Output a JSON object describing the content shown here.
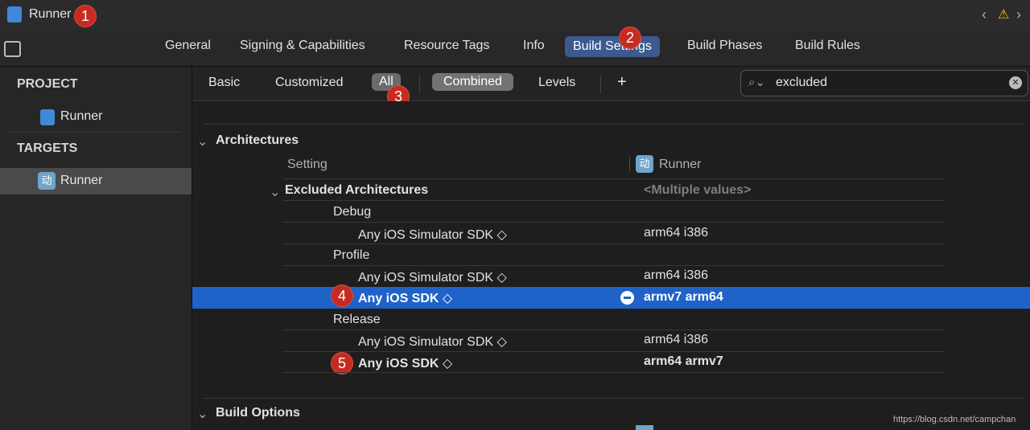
{
  "window": {
    "title": "Runner"
  },
  "badges": [
    "1",
    "2",
    "3",
    "4",
    "5"
  ],
  "tabs": [
    "General",
    "Signing & Capabilities",
    "Resource Tags",
    "Info",
    "Build Settings",
    "Build Phases",
    "Build Rules"
  ],
  "sidebar": {
    "project_header": "PROJECT",
    "project_item": "Runner",
    "targets_header": "TARGETS",
    "target_item": "Runner",
    "target_icon_glyph": "动"
  },
  "filters": {
    "basic": "Basic",
    "customized": "Customized",
    "all": "All",
    "combined": "Combined",
    "levels": "Levels",
    "add": "+"
  },
  "search": {
    "value": "excluded"
  },
  "content": {
    "section1": "Architectures",
    "col_setting": "Setting",
    "col_target": "Runner",
    "setting_name": "Excluded Architectures",
    "setting_value": "<Multiple values>",
    "debug": "Debug",
    "debug_sim": "Any iOS Simulator SDK ◇",
    "debug_sim_val": "arm64 i386",
    "profile": "Profile",
    "profile_sim": "Any iOS Simulator SDK ◇",
    "profile_sim_val": "arm64 i386",
    "profile_sdk": "Any iOS SDK ◇",
    "profile_sdk_val": "armv7 arm64",
    "release": "Release",
    "release_sim": "Any iOS Simulator SDK ◇",
    "release_sim_val": "arm64 i386",
    "release_sdk": "Any iOS SDK ◇",
    "release_sdk_val": "arm64 armv7",
    "section2": "Build Options"
  },
  "watermark": "https://blog.csdn.net/campchan",
  "colors": {
    "accent": "#1f63c9",
    "badge": "#c62b22",
    "active_tab": "#3d5a8e"
  }
}
